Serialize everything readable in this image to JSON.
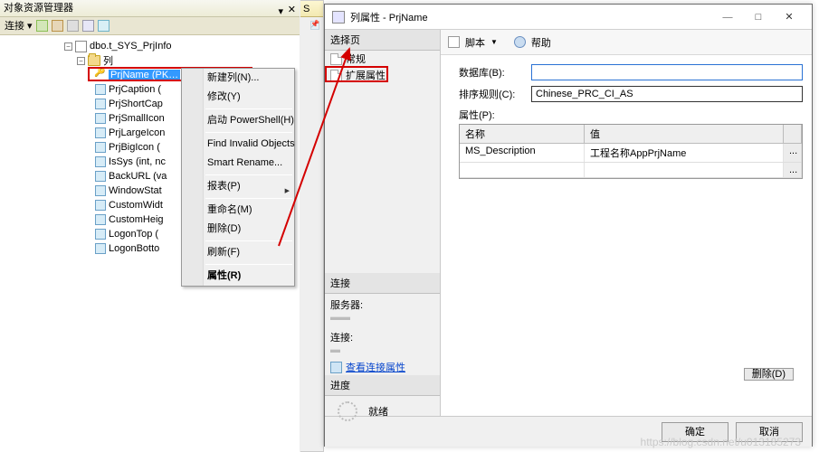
{
  "left_panel": {
    "title": "对象资源管理器",
    "toolbar": {
      "connect": "连接 ▾"
    },
    "tree": {
      "db_node": "dbo.t_SYS_PrjInfo",
      "cols_node": "列",
      "items": [
        "PrjName (PK…",
        "PrjCaption (",
        "PrjShortCap",
        "PrjSmallIcon",
        "PrjLargeIcon",
        "PrjBigIcon (",
        "IsSys (int, nc",
        "BackURL (va",
        "WindowStat",
        "CustomWidt",
        "CustomHeig",
        "LogonTop (",
        "LogonBotto"
      ]
    }
  },
  "context_menu": {
    "items": [
      "新建列(N)...",
      "修改(Y)",
      "启动 PowerShell(H)",
      "Find Invalid Objects",
      "Smart Rename...",
      "报表(P)",
      "重命名(M)",
      "删除(D)",
      "刷新(F)",
      "属性(R)"
    ]
  },
  "mid_tab": "S",
  "dialog": {
    "title": "列属性 - PrjName",
    "win": {
      "min": "—",
      "max": "□",
      "close": "✕"
    },
    "nav": {
      "h_pages": "选择页",
      "p_general": "常规",
      "p_ext": "扩展属性",
      "h_conn": "连接",
      "l_server": "服务器:",
      "l_conn": "连接:",
      "link_conn": "查看连接属性",
      "h_prog": "进度",
      "prog": "就绪"
    },
    "toolbar": {
      "script": "脚本",
      "help": "帮助"
    },
    "form": {
      "l_db": "数据库(B):",
      "v_db": "",
      "l_sort": "排序规则(C):",
      "v_sort": "Chinese_PRC_CI_AS",
      "l_props": "属性(P):",
      "gh_name": "名称",
      "gh_value": "值",
      "r1_name": "MS_Description",
      "r1_value": "工程名称AppPrjName",
      "ell": "..."
    },
    "btn_delete": "删除(D)",
    "btn_ok": "确定",
    "btn_cancel": "取消"
  },
  "watermark": "https://blog.csdn.net/u013185273"
}
